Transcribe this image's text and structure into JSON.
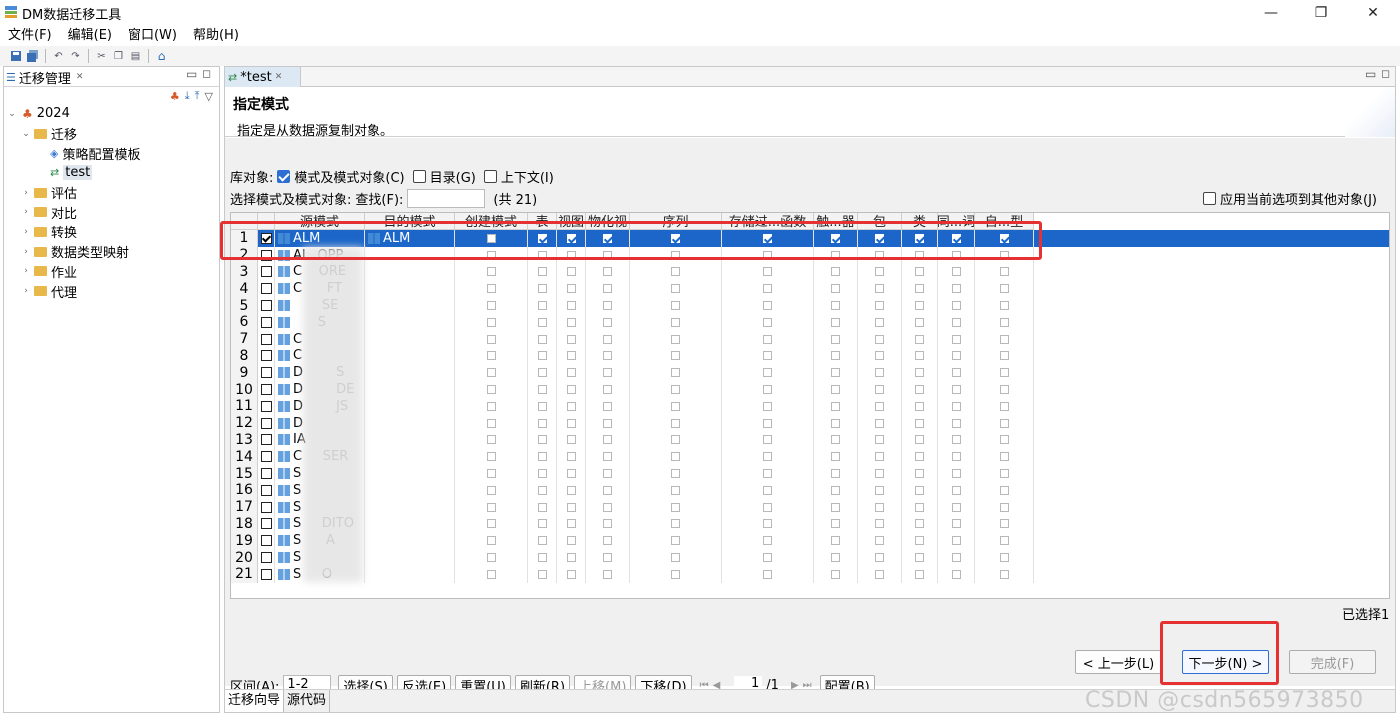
{
  "window": {
    "title": "DM数据迁移工具",
    "minimize": "—",
    "restore": "❐",
    "close": "✕"
  },
  "menu": [
    "文件(F)",
    "编辑(E)",
    "窗口(W)",
    "帮助(H)"
  ],
  "left_panel": {
    "tab_label": "迁移管理",
    "close_glyph": "✕",
    "tree": [
      {
        "label": "2024",
        "level": 0,
        "expanded": true,
        "icon": "project-icon"
      },
      {
        "label": "迁移",
        "level": 1,
        "expanded": true,
        "icon": "folder-icon"
      },
      {
        "label": "策略配置模板",
        "level": 2,
        "icon": "template-icon"
      },
      {
        "label": "test",
        "level": 2,
        "icon": "migration-icon",
        "selected": true
      },
      {
        "label": "评估",
        "level": 1,
        "expanded": false,
        "icon": "folder-icon"
      },
      {
        "label": "对比",
        "level": 1,
        "expanded": false,
        "icon": "folder-icon"
      },
      {
        "label": "转换",
        "level": 1,
        "expanded": false,
        "icon": "folder-icon"
      },
      {
        "label": "数据类型映射",
        "level": 1,
        "expanded": false,
        "icon": "folder-icon"
      },
      {
        "label": "作业",
        "level": 1,
        "expanded": false,
        "icon": "folder-icon"
      },
      {
        "label": "代理",
        "level": 1,
        "expanded": false,
        "icon": "folder-icon"
      }
    ]
  },
  "editor": {
    "tab_label": "*test",
    "header_title": "指定模式",
    "header_desc": "指定是从数据源复制对象。",
    "db_objects_label": "库对象:",
    "db_options": [
      {
        "label": "模式及模式对象(C)",
        "checked": true
      },
      {
        "label": "目录(G)",
        "checked": false
      },
      {
        "label": "上下文(I)",
        "checked": false
      }
    ],
    "select_label": "选择模式及模式对象:",
    "find_label": "查找(F):",
    "find_value": "",
    "total_label": "(共 21)",
    "apply_label": "应用当前选项到其他对象(J)",
    "columns": [
      "源模式",
      "目的模式",
      "创建模式",
      "表",
      "视图",
      "物化视",
      "序列",
      "存储过...函数",
      "触...器",
      "包",
      "类",
      "同...词",
      "自...型"
    ],
    "rows": [
      {
        "num": "1",
        "checked": true,
        "source": "ALM",
        "target": "ALM",
        "visible_src": "ALM",
        "selected": true
      },
      {
        "num": "2",
        "checked": false,
        "source": "ALMOPP",
        "visible_src": "AL  OPP"
      },
      {
        "num": "3",
        "checked": false,
        "visible_src": "C    ORE"
      },
      {
        "num": "4",
        "checked": false,
        "visible_src": "C      FT"
      },
      {
        "num": "5",
        "checked": false,
        "visible_src": "       SE"
      },
      {
        "num": "6",
        "checked": false,
        "visible_src": "      S"
      },
      {
        "num": "7",
        "checked": false,
        "visible_src": "C"
      },
      {
        "num": "8",
        "checked": false,
        "visible_src": "C"
      },
      {
        "num": "9",
        "checked": false,
        "visible_src": "D        S"
      },
      {
        "num": "10",
        "checked": false,
        "visible_src": "D        DE"
      },
      {
        "num": "11",
        "checked": false,
        "visible_src": "D        JS"
      },
      {
        "num": "12",
        "checked": false,
        "visible_src": "D"
      },
      {
        "num": "13",
        "checked": false,
        "visible_src": "IA"
      },
      {
        "num": "14",
        "checked": false,
        "visible_src": "C     SER"
      },
      {
        "num": "15",
        "checked": false,
        "visible_src": "S"
      },
      {
        "num": "16",
        "checked": false,
        "visible_src": "S"
      },
      {
        "num": "17",
        "checked": false,
        "visible_src": "S"
      },
      {
        "num": "18",
        "checked": false,
        "visible_src": "S     DITO"
      },
      {
        "num": "19",
        "checked": false,
        "visible_src": "S      A"
      },
      {
        "num": "20",
        "checked": false,
        "visible_src": "S"
      },
      {
        "num": "21",
        "checked": false,
        "visible_src": "S     O"
      }
    ],
    "bottom": {
      "range_label": "区间(A):",
      "range_value": "1-2",
      "buttons": [
        {
          "label": "选择(S)",
          "disabled": false
        },
        {
          "label": "反选(E)",
          "disabled": false
        },
        {
          "label": "重置(U)",
          "disabled": false
        },
        {
          "label": "刷新(R)",
          "disabled": false
        },
        {
          "label": "上移(M)",
          "disabled": true
        },
        {
          "label": "下移(D)",
          "disabled": false
        }
      ],
      "page_value": "1",
      "page_total": "/1",
      "config_label": "配置(B)",
      "selected_count": "已选择1"
    },
    "wizard": {
      "prev": "< 上一步(L)",
      "next": "下一步(N) >",
      "finish": "完成(F)"
    },
    "bottom_tabs": [
      "迁移向导",
      "源代码"
    ]
  },
  "watermark": "CSDN @csdn565973850",
  "colors": {
    "accent": "#2f6fd1",
    "selection": "#1b66c8",
    "highlight_box": "#e53131"
  }
}
